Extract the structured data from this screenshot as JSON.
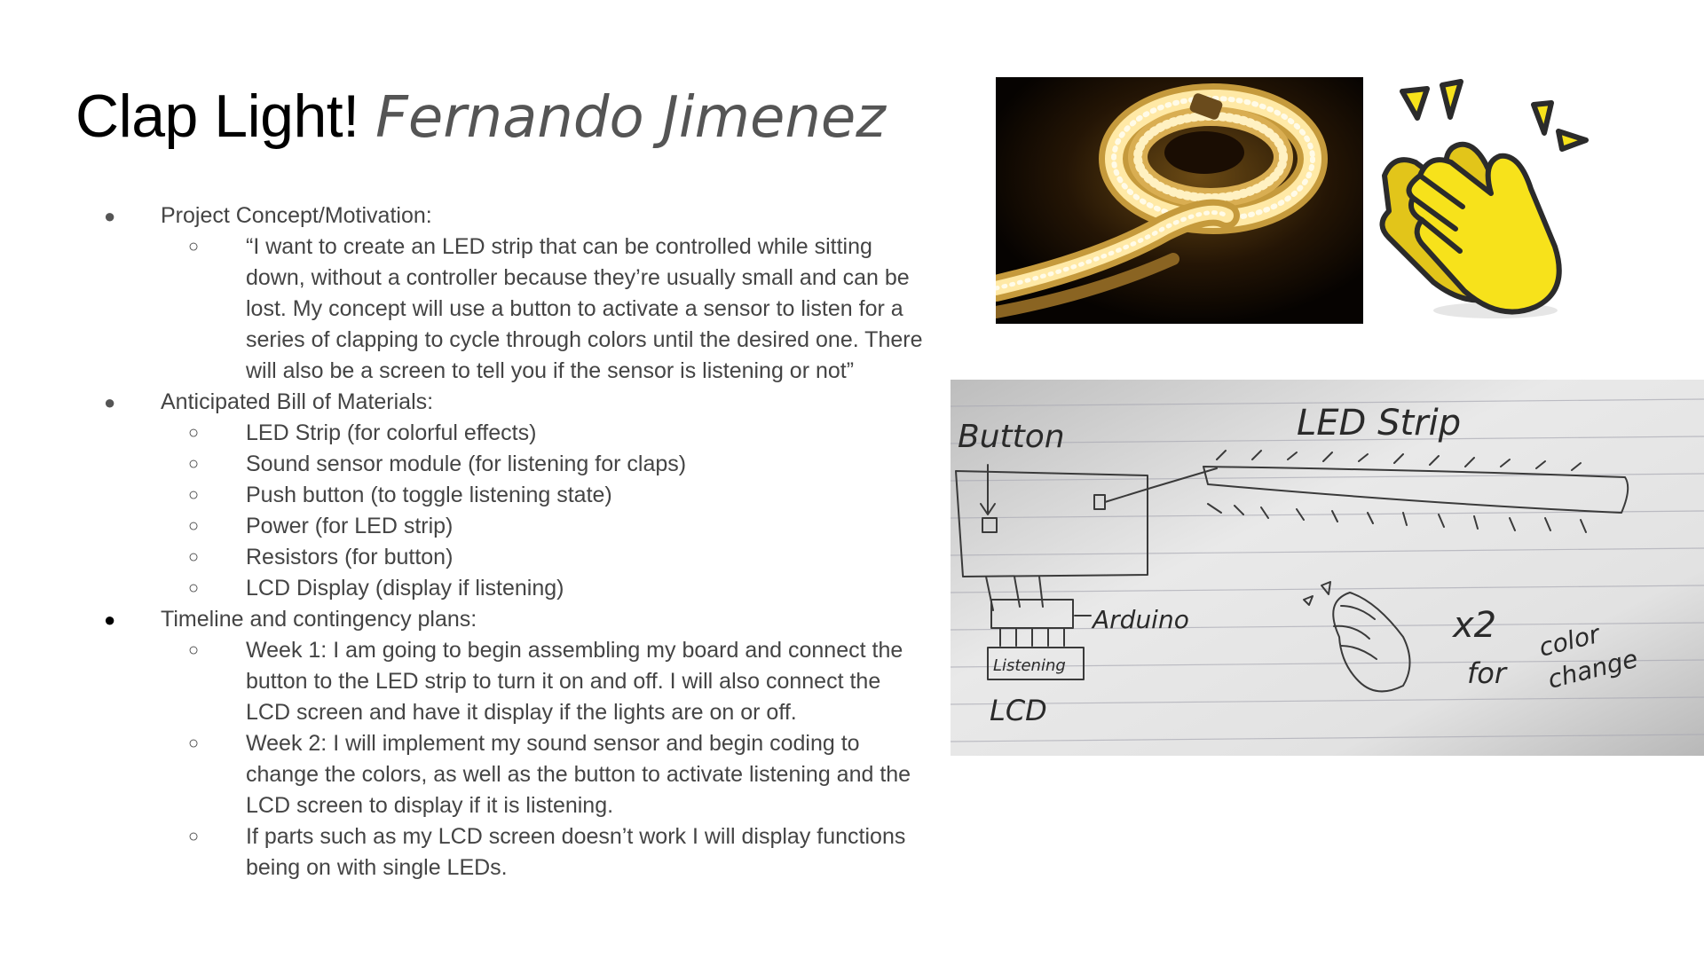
{
  "slide": {
    "title": "Clap Light!",
    "author": "Fernando Jimenez",
    "sections": [
      {
        "heading": "Project Concept/Motivation:",
        "items": [
          "“I want to create an LED strip that can be controlled while sitting down, without a controller because they’re usually small and can be lost. My concept will use a button to activate a sensor to listen for a series of clapping to cycle through colors until the desired one. There will also be a screen to tell you if the sensor is listening or not”"
        ]
      },
      {
        "heading": "Anticipated Bill of Materials:",
        "items": [
          "LED Strip (for colorful effects)",
          "Sound sensor module (for listening for claps)",
          "Push button (to toggle listening state)",
          "Power (for LED strip)",
          "Resistors (for button)",
          "LCD Display (display if listening)"
        ]
      },
      {
        "heading": "Timeline and contingency plans:",
        "items": [
          "Week 1: I am going to begin assembling my board and connect the button to the LED strip to turn it on and off. I will also connect the LCD screen and have it display if the lights are on or off.",
          "Week 2: I will implement my sound sensor and begin coding to change the colors, as well as the button to activate listening and the LCD screen to display if it is listening.",
          "If parts such as my LCD screen doesn’t work I will display functions being on with single LEDs."
        ]
      }
    ],
    "sketch_labels": {
      "button": "Button",
      "led_strip": "LED Strip",
      "arduino": "Arduino",
      "listening": "Listening",
      "lcd": "LCD",
      "times_two": "x2",
      "for": "for",
      "color": "color",
      "change": "change"
    }
  }
}
